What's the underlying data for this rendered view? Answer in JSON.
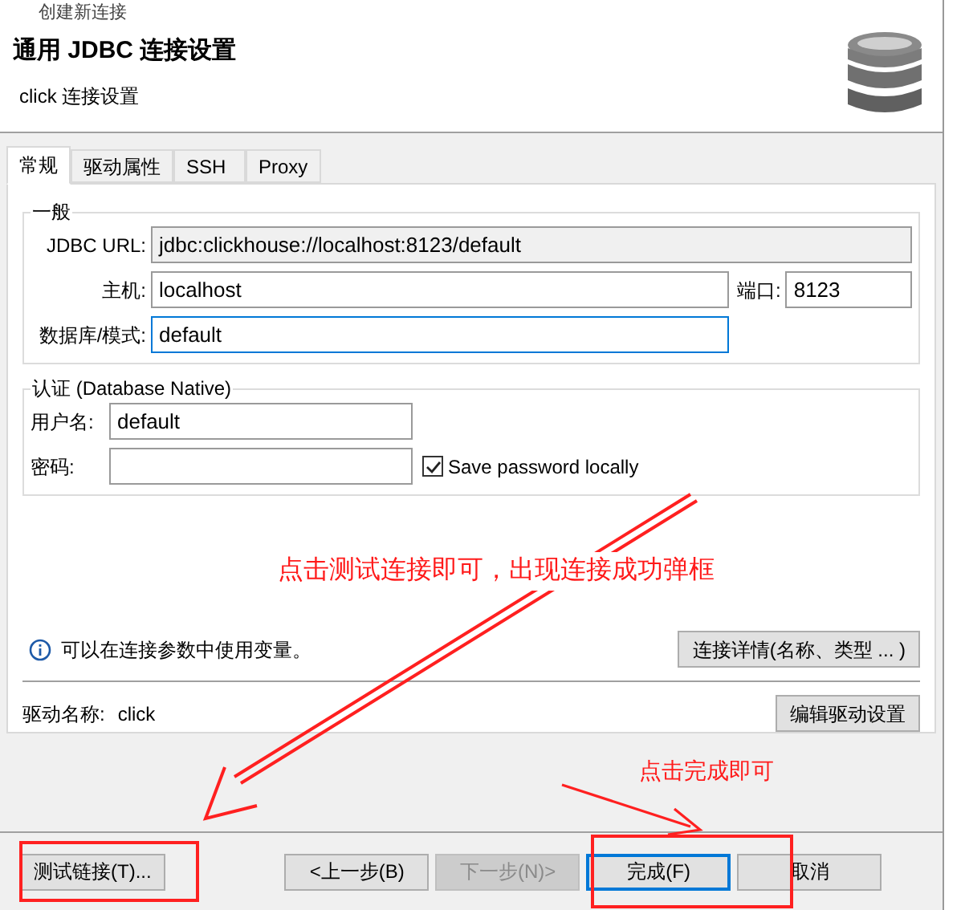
{
  "window": {
    "title": "创建新连接"
  },
  "header": {
    "title": "通用 JDBC 连接设置",
    "subtitle": "click 连接设置"
  },
  "tabs": [
    {
      "label": "常规",
      "selected": true
    },
    {
      "label": "驱动属性",
      "selected": false
    },
    {
      "label": "SSH",
      "selected": false
    },
    {
      "label": "Proxy",
      "selected": false
    }
  ],
  "general": {
    "legend": "一般",
    "jdbc_url_label": "JDBC URL:",
    "jdbc_url": "jdbc:clickhouse://localhost:8123/default",
    "host_label": "主机:",
    "host": "localhost",
    "port_label": "端口:",
    "port": "8123",
    "database_label": "数据库/模式:",
    "database": "default"
  },
  "auth": {
    "legend": "认证 (Database Native)",
    "username_label": "用户名:",
    "username": "default",
    "password_label": "密码:",
    "save_password": {
      "label": "Save password locally",
      "checked": true
    }
  },
  "info": {
    "text": "可以在连接参数中使用变量。",
    "button": "连接详情(名称、类型 ... )"
  },
  "driver": {
    "label": "驱动名称:",
    "name": "click",
    "button": "编辑驱动设置"
  },
  "footer": {
    "test_button": "测试链接(T)...",
    "buttons": [
      {
        "label": "<上一步(B)",
        "disabled": false,
        "selected": false
      },
      {
        "label": "下一步(N)>",
        "disabled": true,
        "selected": false
      },
      {
        "label": "完成(F)",
        "disabled": false,
        "selected": true
      },
      {
        "label": "取消",
        "disabled": false,
        "selected": false
      }
    ]
  },
  "annotations": [
    {
      "text": "点击测试连接即可，出现连接成功弹框"
    },
    {
      "text": "点击完成即可"
    }
  ]
}
